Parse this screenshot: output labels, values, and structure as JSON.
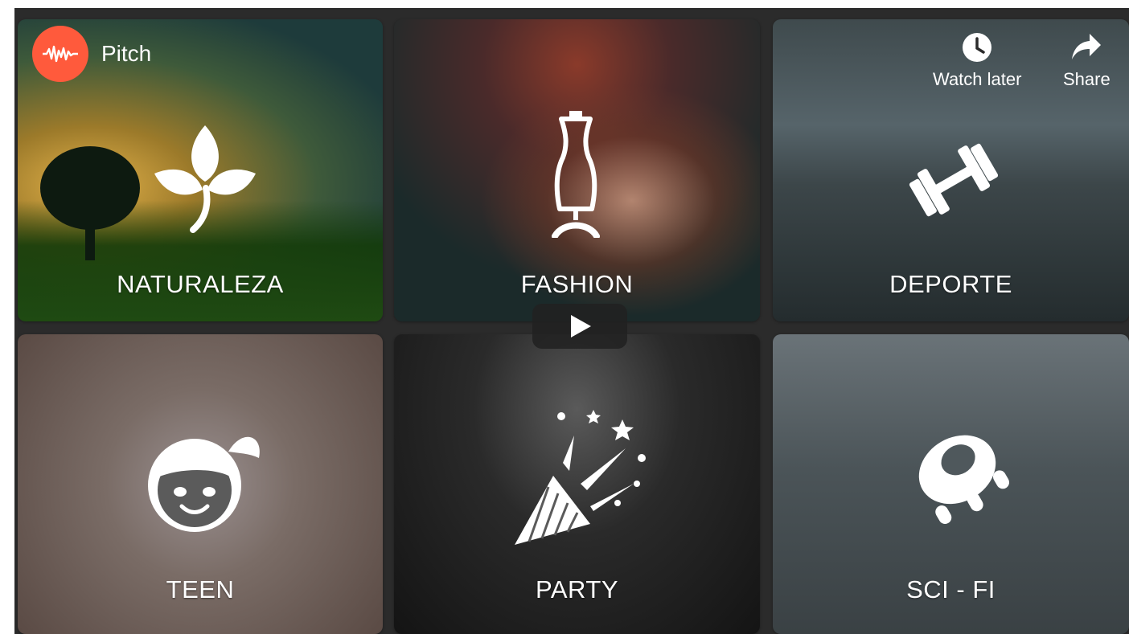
{
  "channel": {
    "name": "Pitch",
    "logo_icon": "waveform-icon",
    "logo_color": "#ff5a3c"
  },
  "actions": {
    "watch_later": {
      "label": "Watch later",
      "icon": "clock-icon"
    },
    "share": {
      "label": "Share",
      "icon": "share-arrow-icon"
    }
  },
  "player": {
    "play_icon": "play-icon"
  },
  "tiles": [
    {
      "label": "NATURALEZA",
      "icon": "leaf-icon"
    },
    {
      "label": "FASHION",
      "icon": "dress-form-icon"
    },
    {
      "label": "DEPORTE",
      "icon": "dumbbell-icon"
    },
    {
      "label": "TEEN",
      "icon": "girl-face-icon"
    },
    {
      "label": "PARTY",
      "icon": "party-popper-icon"
    },
    {
      "label": "SCI - FI",
      "icon": "ufo-icon"
    }
  ]
}
